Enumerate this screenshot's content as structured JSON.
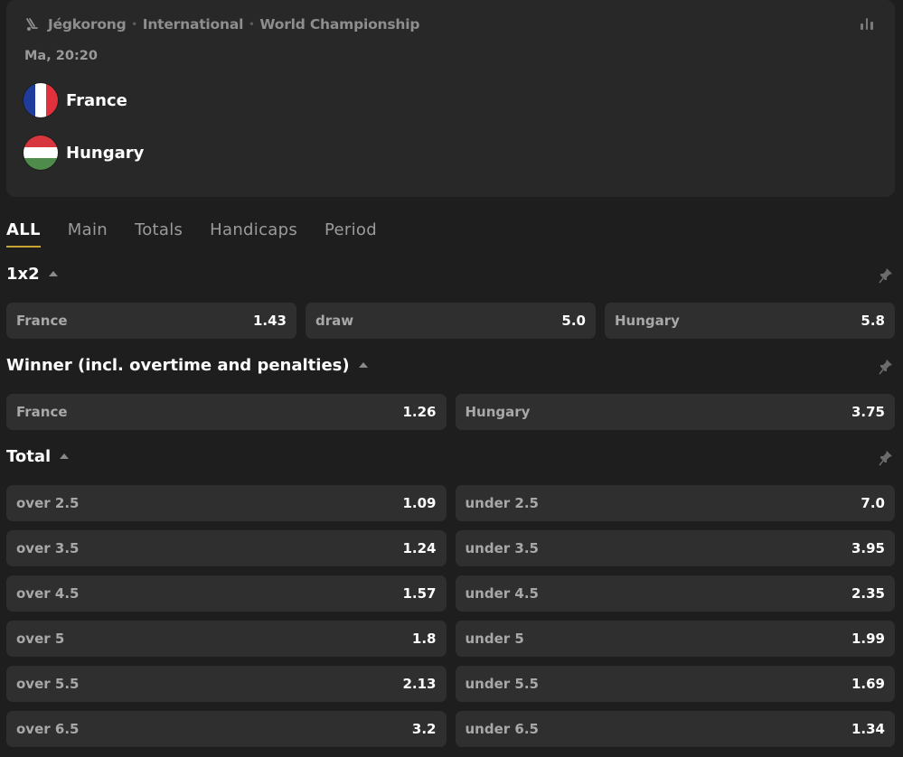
{
  "event": {
    "breadcrumb": [
      "Jégkorong",
      "International",
      "World Championship"
    ],
    "sport_icon": "hockey-icon",
    "time": "Ma, 20:20",
    "home": {
      "name": "France",
      "flag_colors": [
        "#1f3c9c",
        "#ffffff",
        "#e0313c"
      ]
    },
    "away": {
      "name": "Hungary",
      "flag_colors": [
        "#d7363c",
        "#ffffff",
        "#4f8b4a"
      ]
    }
  },
  "tabs": [
    "ALL",
    "Main",
    "Totals",
    "Handicaps",
    "Period"
  ],
  "active_tab": "ALL",
  "markets": {
    "m1x2": {
      "title": "1x2",
      "outcomes": [
        {
          "label": "France",
          "odd": "1.43"
        },
        {
          "label": "draw",
          "odd": "5.0"
        },
        {
          "label": "Hungary",
          "odd": "5.8"
        }
      ]
    },
    "winner": {
      "title": "Winner (incl. overtime and penalties)",
      "outcomes": [
        {
          "label": "France",
          "odd": "1.26"
        },
        {
          "label": "Hungary",
          "odd": "3.75"
        }
      ]
    },
    "total": {
      "title": "Total",
      "rows": [
        [
          {
            "label": "over 2.5",
            "odd": "1.09"
          },
          {
            "label": "under 2.5",
            "odd": "7.0"
          }
        ],
        [
          {
            "label": "over 3.5",
            "odd": "1.24"
          },
          {
            "label": "under 3.5",
            "odd": "3.95"
          }
        ],
        [
          {
            "label": "over 4.5",
            "odd": "1.57"
          },
          {
            "label": "under 4.5",
            "odd": "2.35"
          }
        ],
        [
          {
            "label": "over 5",
            "odd": "1.8"
          },
          {
            "label": "under 5",
            "odd": "1.99"
          }
        ],
        [
          {
            "label": "over 5.5",
            "odd": "2.13"
          },
          {
            "label": "under 5.5",
            "odd": "1.69"
          }
        ],
        [
          {
            "label": "over 6.5",
            "odd": "3.2"
          },
          {
            "label": "under 6.5",
            "odd": "1.34"
          }
        ]
      ]
    }
  },
  "colors": {
    "accent": "#c8a433",
    "background": "#1e1e1e",
    "card": "#282828",
    "button": "#2f2f2f"
  }
}
